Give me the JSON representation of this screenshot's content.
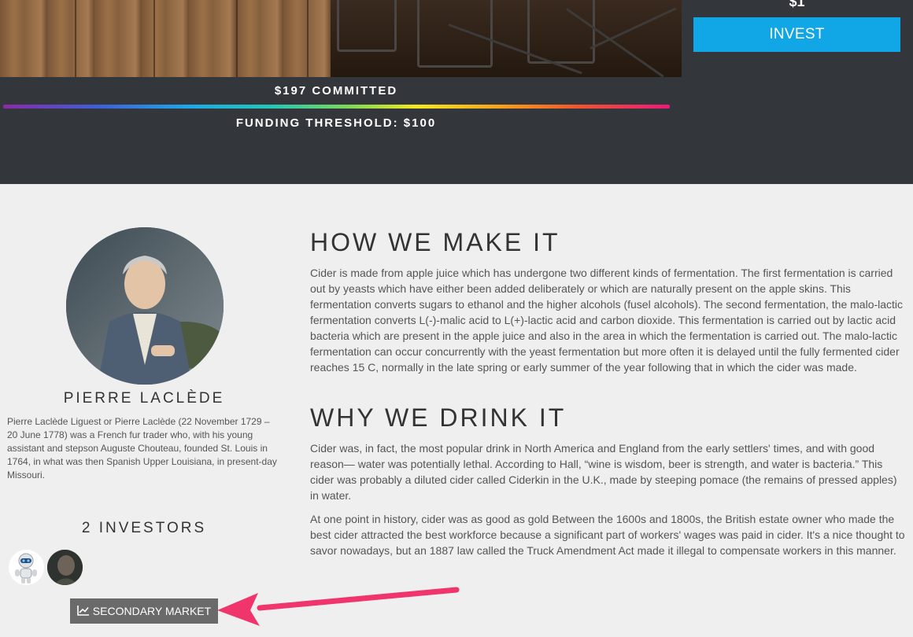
{
  "hero": {
    "price": "$1",
    "invest_label": "INVEST",
    "committed": "$197 COMMITTED",
    "threshold": "FUNDING THRESHOLD: $100"
  },
  "person": {
    "name": "PIERRE LACLÈDE",
    "bio": "Pierre Laclède Liguest or Pierre Laclède (22 November 1729 – 20 June 1778) was a French fur trader who, with his young assistant and stepson Auguste Chouteau, founded St. Louis in 1764, in what was then Spanish Upper Louisiana, in present-day Missouri."
  },
  "investors": {
    "title": "2 INVESTORS",
    "secondary_market_label": "SECONDARY MARKET"
  },
  "content": {
    "how_title": "HOW WE MAKE IT",
    "how_text": "Cider is made from apple juice which has undergone two different kinds of fermentation. The first fermentation is carried out by yeasts which have either been added deliberately or which are naturally present on the apple skins. This fermentation converts sugars to ethanol and the higher alcohols (fusel alcohols). The second fermentation, the malo-lactic fermentation converts L(-)-malic acid to L(+)-lactic acid and carbon dioxide. This fermentation is carried out by lactic acid bacteria which are present in the apple juice and also in the area in which the fermentation is carried out. The malo-lactic fermentation can occur concurrently with the yeast fermentation but more often it is delayed until the fully fermented cider reaches 15 C, normally in the late spring or early summer of the year following that in which the cider was made.",
    "why_title": "WHY WE DRINK IT",
    "why_text_1": "Cider was, in fact, the most popular drink in North America and England from the early settlers' times, and with good reason— water was potentially lethal. According to Hall, “wine is wisdom, beer is strength, and water is bacteria.” This cider was probably a diluted cider called Ciderkin in the U.K., made by steeping pomace (the remains of pressed apples) in water.",
    "why_text_2": "At one point in history, cider was as good as gold Between the 1600s and 1800s, the British estate owner who made the best cider attracted the best workforce because a significant part of workers' wages was paid in cider. It's a nice thought to savor nowadays, but an 1887 law called the Truck Amendment Act made it illegal to compensate workers in this manner."
  },
  "colors": {
    "accent": "#11a7e6",
    "dark_band": "#33373c",
    "annotation_arrow": "#f0356d"
  }
}
